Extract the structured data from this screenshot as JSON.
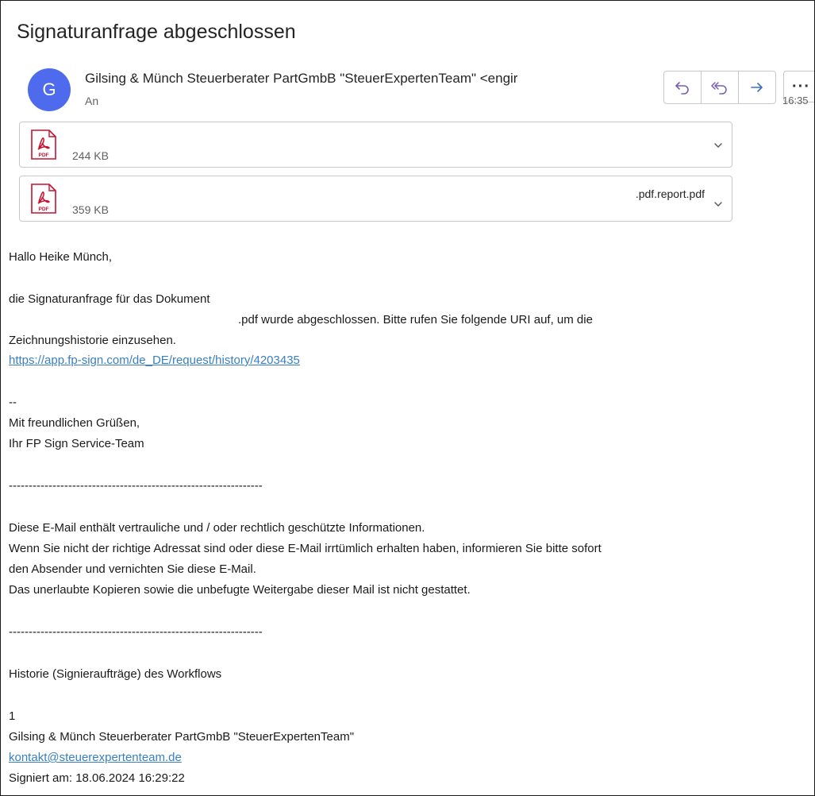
{
  "email": {
    "subject": "Signaturanfrage abgeschlossen",
    "avatar_initial": "G",
    "sender": "Gilsing & Münch Steuerberater PartGmbB \"SteuerExpertenTeam\" <engir",
    "to_label": "An",
    "time": "16:35",
    "more_label": "···"
  },
  "attachments": [
    {
      "size": "244 KB",
      "filename": ""
    },
    {
      "size": "359 KB",
      "filename": ".pdf.report.pdf"
    }
  ],
  "body": {
    "greeting": "Hallo Heike Münch,",
    "p1_line1": "die Signaturanfrage für das Dokument",
    "p1_line2": ".pdf wurde abgeschlossen. Bitte rufen Sie folgende URI auf, um die",
    "p1_line3": "Zeichnungshistorie einzusehen.",
    "history_link": "https://app.fp-sign.com/de_DE/request/history/4203435",
    "sig_dash": "--",
    "closing": "Mit freundlichen Grüßen,",
    "team": "Ihr FP Sign Service-Team",
    "separator": "----------------------------------------------------------------",
    "conf1": "Diese E-Mail enthält vertrauliche und / oder rechtlich geschützte Informationen.",
    "conf2": "Wenn Sie nicht der richtige Adressat sind oder diese E-Mail irrtümlich erhalten haben, informieren Sie bitte sofort",
    "conf3": "den Absender und vernichten Sie diese E-Mail.",
    "conf4": "Das unerlaubte Kopieren sowie die unbefugte Weitergabe dieser Mail ist nicht gestattet.",
    "history_title": "Historie (Signieraufträge) des Workflows",
    "entry_num": "1",
    "entry_name": "Gilsing & Münch Steuerberater PartGmbB \"SteuerExpertenTeam\"",
    "entry_email": "kontakt@steuerexpertenteam.de",
    "entry_signed": "Signiert am: 18.06.2024 16:29:22"
  },
  "colors": {
    "accent": "#4f6bed",
    "link": "#3a7fbf",
    "pdf_red": "#c8102e",
    "action_icon": "#7a5bb5"
  }
}
